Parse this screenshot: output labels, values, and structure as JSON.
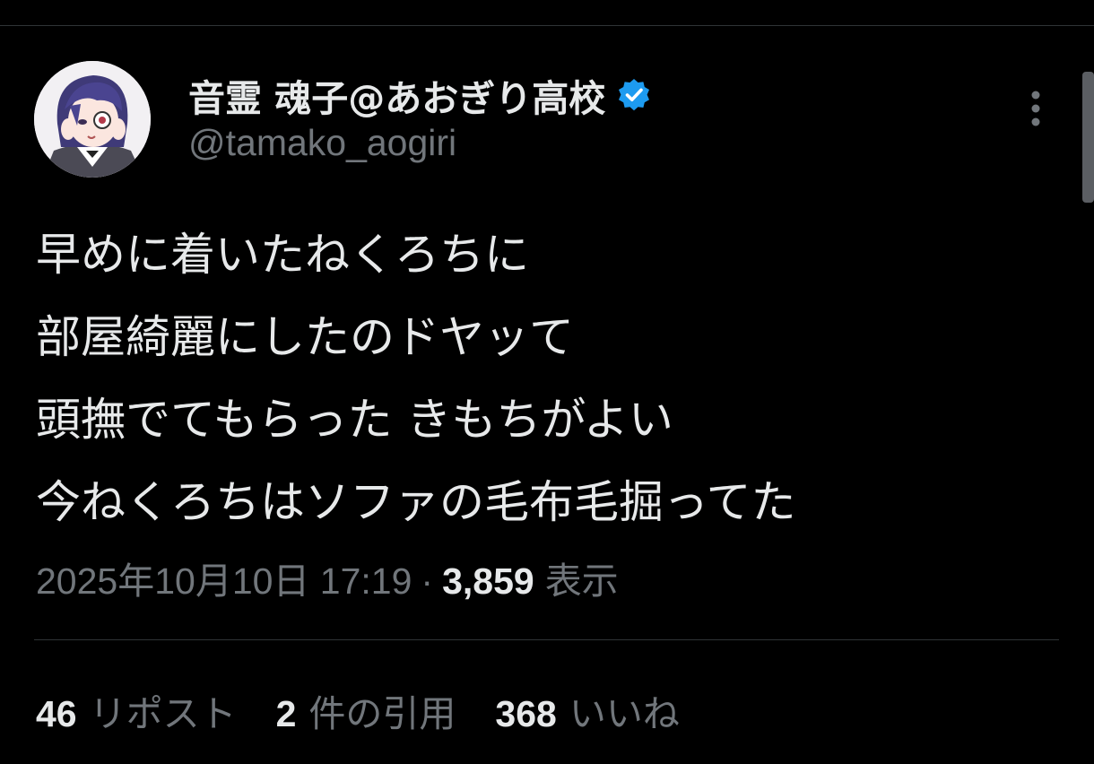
{
  "author": {
    "display_name": "音霊 魂子@あおぎり高校",
    "handle": "@tamako_aogiri",
    "verified_icon": "verified-badge-icon"
  },
  "tweet": {
    "lines": [
      "早めに着いたねくろちに",
      "部屋綺麗にしたのドヤッて",
      "頭撫でてもらった きもちがよい",
      "今ねくろちはソファの毛布毛掘ってた"
    ]
  },
  "meta": {
    "timestamp": "2025年10月10日 17:19",
    "separator": "·",
    "views_count": "3,859",
    "views_label": "表示"
  },
  "stats": {
    "reposts_count": "46",
    "reposts_label": "リポスト",
    "quotes_count": "2",
    "quotes_label": "件の引用",
    "likes_count": "368",
    "likes_label": "いいね"
  },
  "colors": {
    "background": "#000000",
    "text_primary": "#e7e9ea",
    "text_secondary": "#71767b",
    "divider": "#2f3336",
    "verified_blue": "#1d9bf0"
  }
}
